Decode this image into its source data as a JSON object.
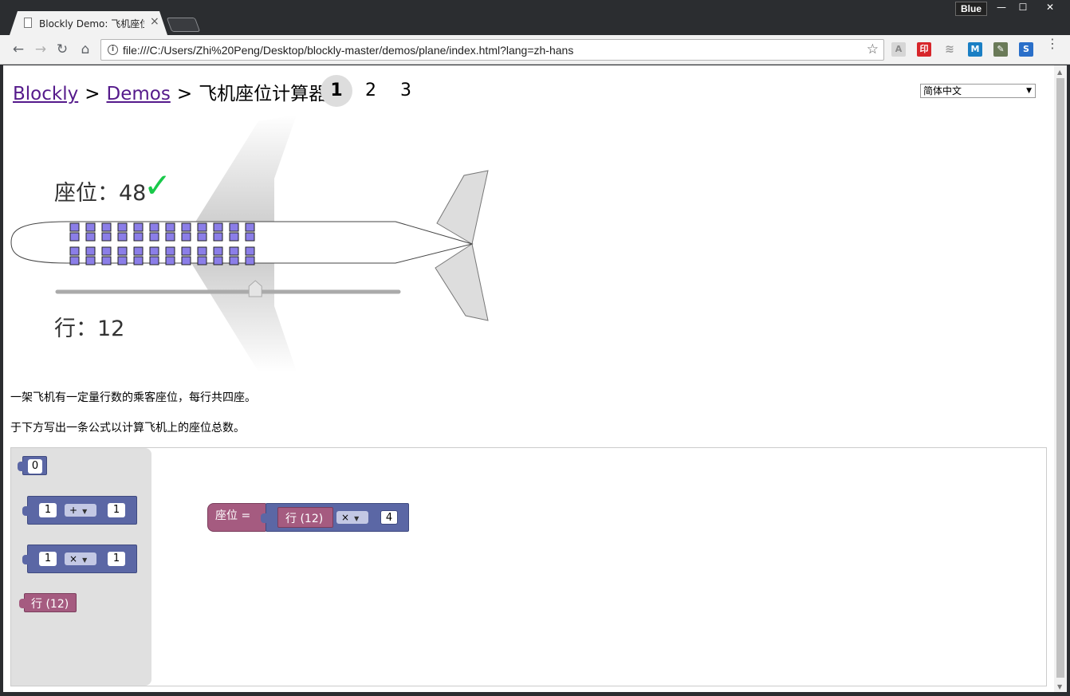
{
  "browser": {
    "tab_title": "Blockly Demo: 飞机座位",
    "tab_close": "×",
    "profile_name": "Blue",
    "win_min": "—",
    "win_max": "☐",
    "win_close": "✕",
    "url": "file:///C:/Users/Zhi%20Peng/Desktop/blockly-master/demos/plane/index.html?lang=zh-hans",
    "info_icon": "i",
    "star_icon": "☆",
    "nav": {
      "back": "←",
      "forward": "→",
      "reload": "↻",
      "home": "⌂"
    },
    "extensions": [
      "A",
      "印",
      "≋",
      "M",
      "✎",
      "S"
    ],
    "menu": "⋮"
  },
  "page": {
    "breadcrumb": {
      "blockly": "Blockly",
      "sep1": ">",
      "demos": "Demos",
      "sep2": ">",
      "title": "飞机座位计算器"
    },
    "levels": [
      "1",
      "2",
      "3"
    ],
    "active_level": "1",
    "language": "简体中文",
    "seat_text": "座位：48",
    "check": "✓",
    "row_text": "行：12",
    "description_1": "一架飞机有一定量行数的乘客座位，每行共四座。",
    "description_2": "于下方写出一条公式以计算飞机上的座位总数。",
    "slider_fraction": 0.58,
    "seat_rows": 12,
    "colors": {
      "seat": "#8b7ee8",
      "check": "#19c94a",
      "math_block": "#5b67a5",
      "variable_block": "#a55b80",
      "link": "#551a8b"
    }
  },
  "toolbox": {
    "number_block": "0",
    "add_block": {
      "left": "1",
      "op": "+",
      "right": "1"
    },
    "mul_block": {
      "left": "1",
      "op": "×",
      "right": "1"
    },
    "row_block": "行 (12)"
  },
  "workspace": {
    "set_label": "座位 =",
    "row_block": "行 (12)",
    "op": "×",
    "value": "4"
  }
}
